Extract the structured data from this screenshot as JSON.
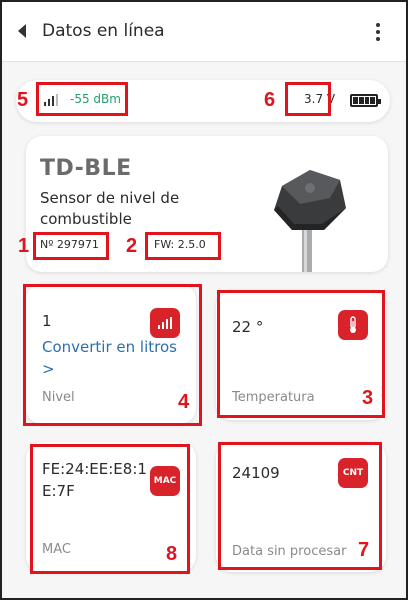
{
  "header": {
    "title": "Datos en línea"
  },
  "status": {
    "signal": "-55 dBm",
    "voltage": "3.7 V"
  },
  "device": {
    "model": "TD-BLE",
    "description": "Sensor de nivel de combustible",
    "serial": "Nº 297971",
    "firmware": "FW: 2.5.0"
  },
  "tiles": {
    "level": {
      "value": "1",
      "link": "Convertir en litros >",
      "label": "Nivel"
    },
    "temperature": {
      "value": "22 °",
      "label": "Temperatura"
    },
    "mac": {
      "value": "FE:24:EE:E8:1E:7F",
      "label": "MAC",
      "badge": "MAC"
    },
    "raw": {
      "value": "24109",
      "label": "Data sin procesar",
      "badge": "CNT"
    }
  },
  "annotations": [
    "1",
    "2",
    "3",
    "4",
    "5",
    "6",
    "7",
    "8"
  ],
  "colors": {
    "accent": "#d8232a",
    "annotation": "#e0141c",
    "signal": "#22a26b",
    "link": "#2c6fb1"
  }
}
